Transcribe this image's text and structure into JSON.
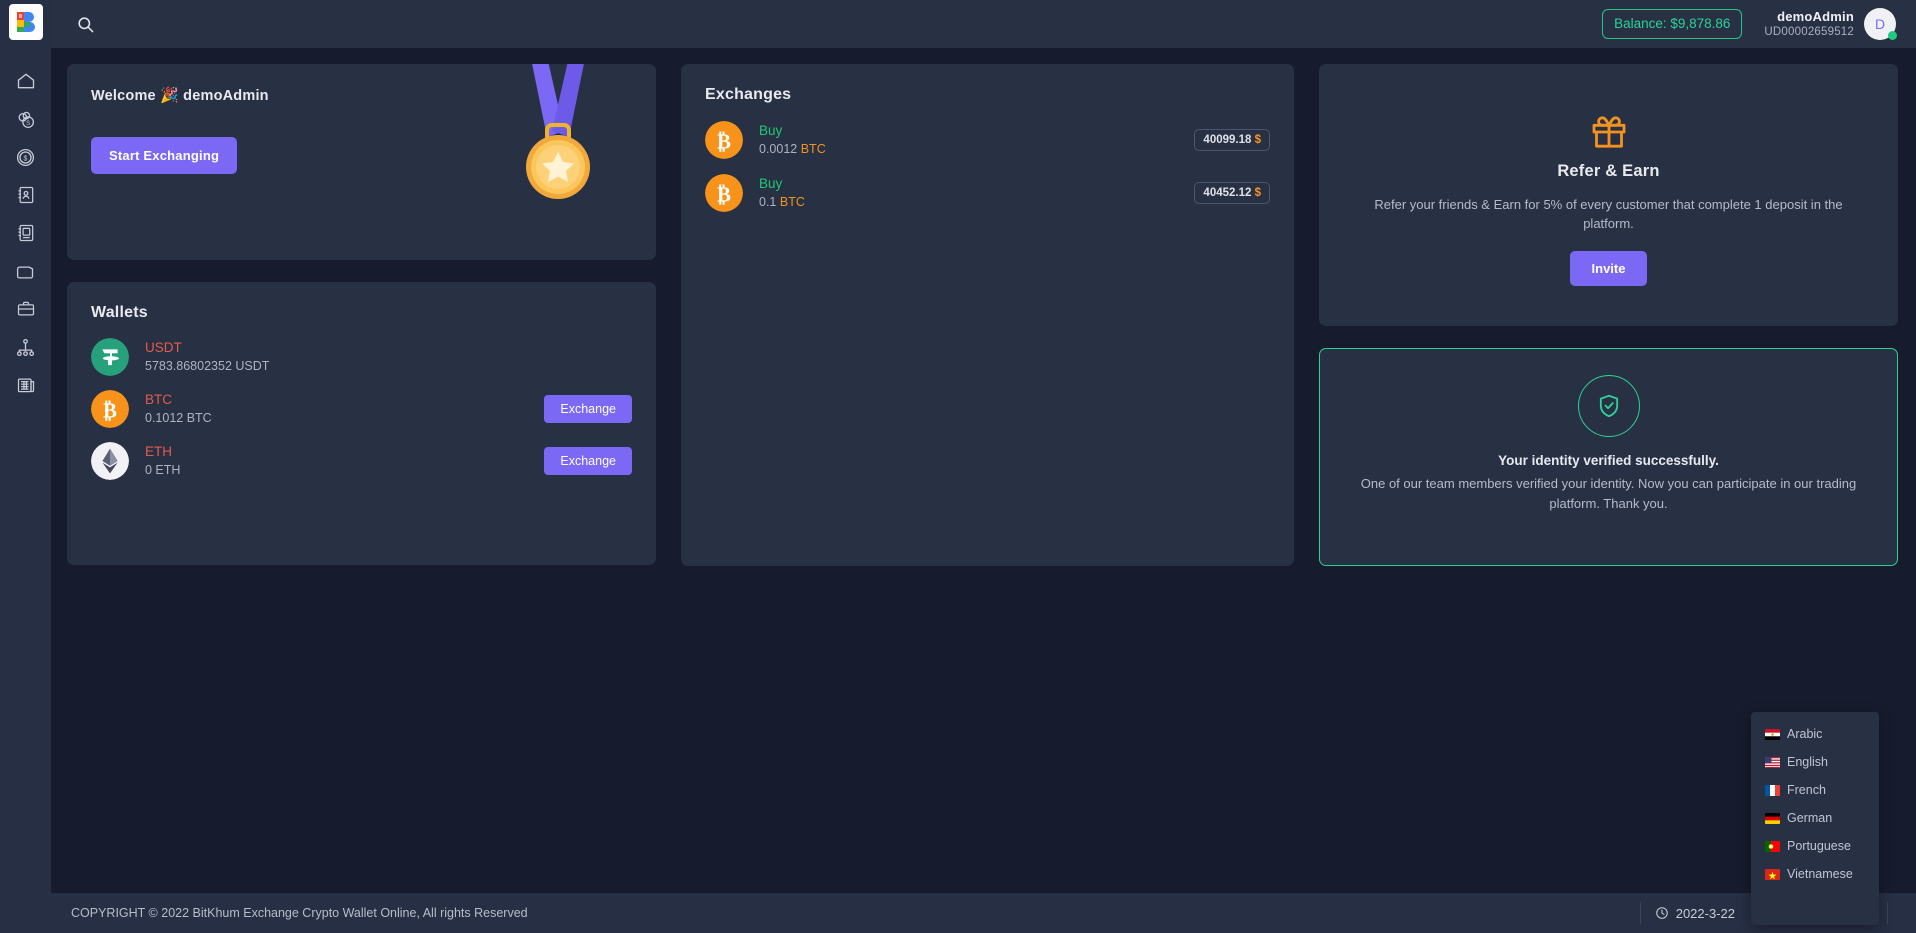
{
  "brand": {
    "logo_letter": "B",
    "logo_alt": "bitkhum-logo"
  },
  "sidebar": {
    "items": [
      {
        "name": "home",
        "icon": "home-icon"
      },
      {
        "name": "coins",
        "icon": "coins-icon"
      },
      {
        "name": "dollar",
        "icon": "dollar-coin-icon"
      },
      {
        "name": "contacts",
        "icon": "contact-book-icon"
      },
      {
        "name": "orders",
        "icon": "order-book-icon"
      },
      {
        "name": "wallet",
        "icon": "wallet-icon"
      },
      {
        "name": "portfolio",
        "icon": "briefcase-icon"
      },
      {
        "name": "network",
        "icon": "sitemap-icon"
      },
      {
        "name": "reports",
        "icon": "news-report-icon"
      }
    ]
  },
  "topbar": {
    "search_icon": "search-icon",
    "balance_label": "Balance: $9,878.86",
    "user_name": "demoAdmin",
    "user_id": "UD00002659512",
    "avatar_letter": "D"
  },
  "welcome": {
    "title_prefix": "Welcome",
    "emoji": "🎉",
    "user": "demoAdmin",
    "full_title": "Welcome 🎉 demoAdmin",
    "cta_label": "Start Exchanging",
    "decoration": "medal-illustration"
  },
  "wallets": {
    "title": "Wallets",
    "rows": [
      {
        "symbol": "USDT",
        "amount": "5783.86802352 USDT",
        "color": "#26a17b",
        "icon": "tether-icon",
        "action": null
      },
      {
        "symbol": "BTC",
        "amount": "0.1012 BTC",
        "color": "#f7931a",
        "icon": "bitcoin-icon",
        "action": "Exchange"
      },
      {
        "symbol": "ETH",
        "amount": "0 ETH",
        "color": "#e8e8ef",
        "icon": "ethereum-icon",
        "action": "Exchange"
      }
    ]
  },
  "exchanges": {
    "title": "Exchanges",
    "rows": [
      {
        "type": "Buy",
        "amount": "0.0012",
        "unit": "BTC",
        "price": "40099.18",
        "currency": "$",
        "icon": "bitcoin-icon"
      },
      {
        "type": "Buy",
        "amount": "0.1",
        "unit": "BTC",
        "price": "40452.12",
        "currency": "$",
        "icon": "bitcoin-icon"
      }
    ]
  },
  "refer": {
    "icon": "gift-icon",
    "title": "Refer & Earn",
    "description": "Refer your friends & Earn for 5% of every customer that complete 1 deposit in the platform.",
    "button_label": "Invite"
  },
  "verified": {
    "icon": "shield-check-icon",
    "title": "Your identity verified successfully.",
    "description": "One of our team members verified your identity. Now you can participate in our trading platform. Thank you.",
    "border_color": "#2bd293"
  },
  "footer": {
    "copyright": "COPYRIGHT © 2022 BitKhum Exchange Crypto Wallet Online, All rights Reserved",
    "date": "2022-3-22",
    "clock_icon": "clock-icon",
    "chevron_icon": "chevron-right-icon",
    "screen_icon": "screen-icon",
    "theme_icon": "sun-icon"
  },
  "language_menu": {
    "items": [
      {
        "label": "Arabic",
        "flag": "eg"
      },
      {
        "label": "English",
        "flag": "us"
      },
      {
        "label": "French",
        "flag": "fr"
      },
      {
        "label": "German",
        "flag": "de"
      },
      {
        "label": "Portuguese",
        "flag": "pt"
      },
      {
        "label": "Vietnamese",
        "flag": "vn"
      }
    ]
  },
  "colors": {
    "page_bg": "#161c2d",
    "card_bg": "#283044",
    "sidebar_bg": "#272f45",
    "accent_purple": "#7b68f5",
    "accent_green": "#2bd293",
    "accent_orange": "#f3921f",
    "coin_red": "#e45b4d"
  }
}
